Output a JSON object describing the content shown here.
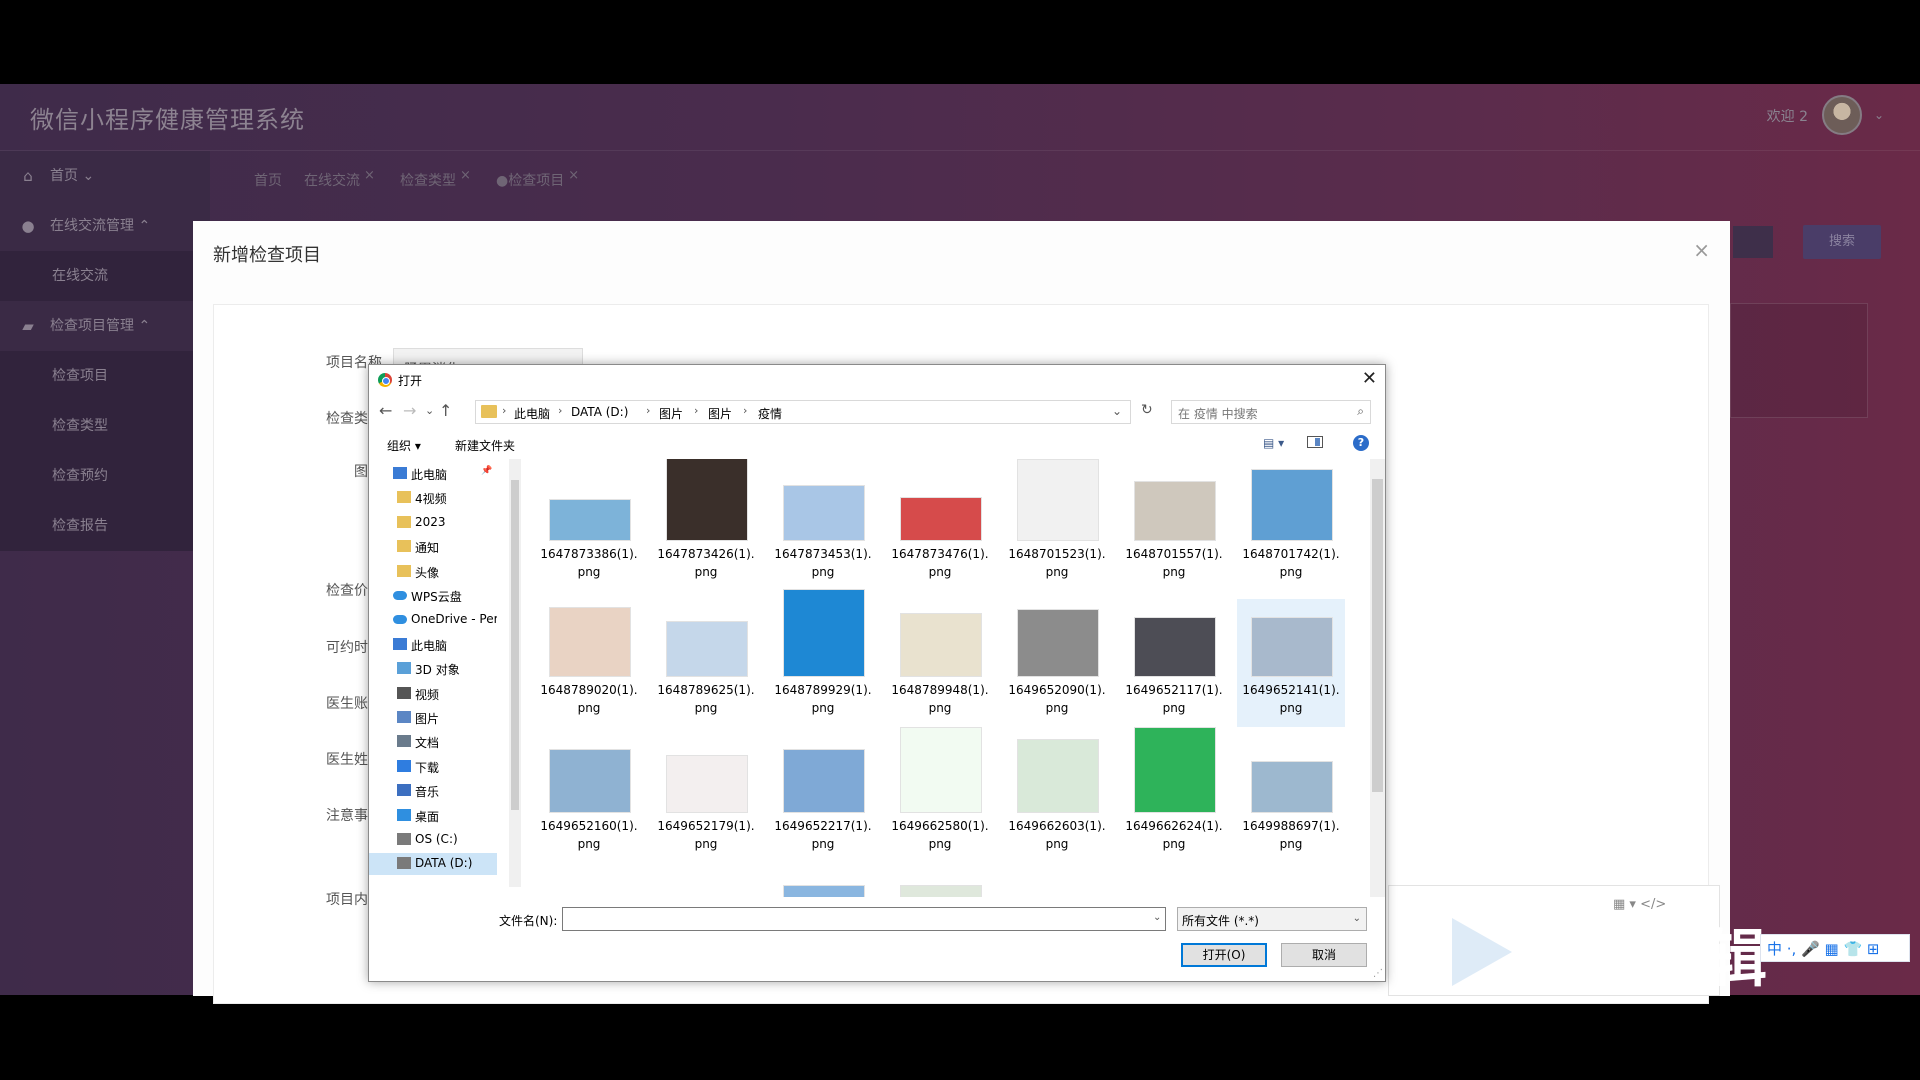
{
  "app": {
    "title": "微信小程序健康管理系统",
    "welcome": "欢迎 2",
    "caret": "⌄"
  },
  "sidebar": {
    "items": [
      {
        "icon": "⌂",
        "label": "首页 ⌄"
      },
      {
        "icon": "●",
        "label": "在线交流管理 ⌃"
      },
      {
        "label": "在线交流"
      },
      {
        "icon": "▰",
        "label": "检查项目管理 ⌃"
      },
      {
        "label": "检查项目"
      },
      {
        "label": "检查类型"
      },
      {
        "label": "检查预约"
      },
      {
        "label": "检查报告"
      }
    ]
  },
  "tabs": [
    {
      "label": "首页"
    },
    {
      "label": "在线交流",
      "close": "×"
    },
    {
      "label": "检查类型",
      "close": "×"
    },
    {
      "label": "●检查项目",
      "close": "×"
    }
  ],
  "search_button": "搜索",
  "modal": {
    "title": "新增检查项目",
    "close": "×",
    "labels": [
      "项目名称",
      "检查类",
      "图",
      "检查价",
      "可约时",
      "医生账",
      "医生姓",
      "注意事",
      "项目内"
    ],
    "project_name_value": "肠胃消化",
    "editor_tools": "▦ ▾    </>"
  },
  "dialog": {
    "title": "打开",
    "close": "✕",
    "nav": {
      "back": "←",
      "forward": "→",
      "down": "⌄",
      "up": "↑"
    },
    "breadcrumbs": [
      "此电脑",
      "DATA (D:)",
      "图片",
      "图片",
      "疫情"
    ],
    "crumb_sep": "›",
    "address_dropdown": "⌄",
    "refresh": "↻",
    "search_placeholder": "在 疫情 中搜索",
    "search_icon": "⌕",
    "organize": "组织 ▾",
    "new_folder": "新建文件夹",
    "view": "▤ ▾",
    "help": "?",
    "tree": [
      {
        "label": "此电脑",
        "icon": "pc",
        "indent": 1,
        "pin": "📌"
      },
      {
        "label": "4视频",
        "icon": "folder",
        "indent": 2
      },
      {
        "label": "2023",
        "icon": "folder",
        "indent": 2
      },
      {
        "label": "通知",
        "icon": "folder",
        "indent": 2
      },
      {
        "label": "头像",
        "icon": "folder",
        "indent": 2
      },
      {
        "label": "WPS云盘",
        "icon": "cloud",
        "indent": 1
      },
      {
        "label": "OneDrive - Perso",
        "icon": "cloud",
        "indent": 1
      },
      {
        "label": "此电脑",
        "icon": "pc",
        "indent": 1
      },
      {
        "label": "3D 对象",
        "icon": "cube",
        "indent": 2
      },
      {
        "label": "视频",
        "icon": "video",
        "indent": 2
      },
      {
        "label": "图片",
        "icon": "image",
        "indent": 2
      },
      {
        "label": "文档",
        "icon": "doc",
        "indent": 2
      },
      {
        "label": "下载",
        "icon": "download",
        "indent": 2
      },
      {
        "label": "音乐",
        "icon": "music",
        "indent": 2
      },
      {
        "label": "桌面",
        "icon": "desktop",
        "indent": 2
      },
      {
        "label": "OS (C:)",
        "icon": "drive",
        "indent": 2
      },
      {
        "label": "DATA (D:)",
        "icon": "drive",
        "indent": 2,
        "selected": true
      }
    ],
    "files": [
      {
        "name": "1647873386(1).",
        "ext": "png",
        "color": "#7db3d9"
      },
      {
        "name": "1647873426(1).",
        "ext": "png",
        "color": "#3a2f2a"
      },
      {
        "name": "1647873453(1).",
        "ext": "png",
        "color": "#a9c6e6"
      },
      {
        "name": "1647873476(1).",
        "ext": "png",
        "color": "#d64b4b"
      },
      {
        "name": "1648701523(1).",
        "ext": "png",
        "color": "#f1f1f1"
      },
      {
        "name": "1648701557(1).",
        "ext": "png",
        "color": "#cfc8bd"
      },
      {
        "name": "1648701742(1).",
        "ext": "png",
        "color": "#5f9fd3"
      },
      {
        "name": "1648789020(1).",
        "ext": "png",
        "color": "#e9d3c4"
      },
      {
        "name": "1648789625(1).",
        "ext": "png",
        "color": "#c5d7ea"
      },
      {
        "name": "1648789929(1).",
        "ext": "png",
        "color": "#1e88d4"
      },
      {
        "name": "1648789948(1).",
        "ext": "png",
        "color": "#e9e2cf"
      },
      {
        "name": "1649652090(1).",
        "ext": "png",
        "color": "#8c8c8c"
      },
      {
        "name": "1649652117(1).",
        "ext": "png",
        "color": "#4d4d55"
      },
      {
        "name": "1649652141(1).",
        "ext": "png",
        "color": "#a8b9cc",
        "selected": true
      },
      {
        "name": "1649652160(1).",
        "ext": "png",
        "color": "#8fb2d2"
      },
      {
        "name": "1649652179(1).",
        "ext": "png",
        "color": "#f3efef"
      },
      {
        "name": "1649652217(1).",
        "ext": "png",
        "color": "#7fa9d6"
      },
      {
        "name": "1649662580(1).",
        "ext": "png",
        "color": "#f2fbf2"
      },
      {
        "name": "1649662603(1).",
        "ext": "png",
        "color": "#d9e9d9"
      },
      {
        "name": "1649662624(1).",
        "ext": "png",
        "color": "#2eb35a"
      },
      {
        "name": "1649988697(1).",
        "ext": "png",
        "color": "#9db8cf"
      }
    ],
    "filename_label": "文件名(N):",
    "filename_value": "",
    "filename_drop": "⌄",
    "filetype": "所有文件 (*.*)",
    "filetype_drop": "⌄",
    "open": "打开(O)",
    "cancel": "取消",
    "grip": "⋰"
  },
  "overlay": {
    "watermark": "辑",
    "ime": "中 ·, 🎤 ▦ 👕 ⊞"
  },
  "colors": {
    "accent": "#0078d7",
    "selection": "#cce4f7",
    "file_selection": "#e5f1fb"
  }
}
